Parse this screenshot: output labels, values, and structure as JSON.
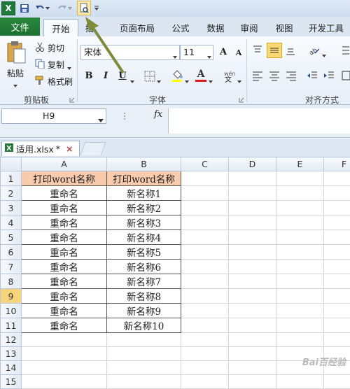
{
  "qat": {
    "logo_letter": "X"
  },
  "tabs": {
    "file": "文件",
    "items": [
      "开始",
      "插",
      "页面布局",
      "公式",
      "数据",
      "审阅",
      "视图",
      "开发工具"
    ]
  },
  "ribbon": {
    "paste": "粘贴",
    "cut": "剪切",
    "copy": "复制",
    "format_painter": "格式刷",
    "clipboard_group": "剪贴板",
    "font_name": "宋体",
    "font_size": "11",
    "font_group": "字体",
    "align_group": "对齐方式",
    "bold": "B",
    "italic": "I",
    "underline": "U",
    "grow": "A",
    "shrink": "A",
    "font_color": "A"
  },
  "formula_bar": {
    "name_box": "H9",
    "fx": "fx"
  },
  "workbook_tab": {
    "name": "适用.xlsx",
    "modified": "*",
    "close": "×"
  },
  "columns": [
    "A",
    "B",
    "C",
    "D",
    "E",
    "F"
  ],
  "rows": [
    {
      "n": "1",
      "a": "打印word名称",
      "b": "打印word名称",
      "header": true
    },
    {
      "n": "2",
      "a": "重命名",
      "b": "新名称1"
    },
    {
      "n": "3",
      "a": "重命名",
      "b": "新名称2"
    },
    {
      "n": "4",
      "a": "重命名",
      "b": "新名称3"
    },
    {
      "n": "5",
      "a": "重命名",
      "b": "新名称4"
    },
    {
      "n": "6",
      "a": "重命名",
      "b": "新名称5"
    },
    {
      "n": "7",
      "a": "重命名",
      "b": "新名称6"
    },
    {
      "n": "8",
      "a": "重命名",
      "b": "新名称7"
    },
    {
      "n": "9",
      "a": "重命名",
      "b": "新名称8",
      "selected": true
    },
    {
      "n": "10",
      "a": "重命名",
      "b": "新名称9"
    },
    {
      "n": "11",
      "a": "重命名",
      "b": "新名称10"
    },
    {
      "n": "12",
      "a": "",
      "b": ""
    },
    {
      "n": "13",
      "a": "",
      "b": ""
    },
    {
      "n": "14",
      "a": "",
      "b": ""
    },
    {
      "n": "15",
      "a": "",
      "b": ""
    }
  ],
  "colors": {
    "header_fill": "#f8cbad",
    "selected_row": "#f7d47a",
    "arrow": "#7d8b3a",
    "file_tab": "#1c6f2f"
  },
  "watermark": "Bai百经验"
}
